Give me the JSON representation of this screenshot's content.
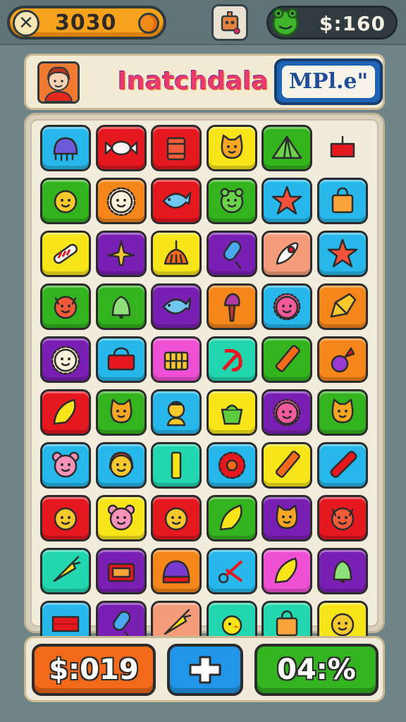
{
  "topbar": {
    "score": "3030",
    "money": "$:160"
  },
  "header": {
    "title": "Inatchdala",
    "mode_label": "MPl.e\""
  },
  "bottom": {
    "left_label": "$:019",
    "mid_label": "",
    "right_label": "04:%"
  },
  "colors": {
    "blue": "#27b7ea",
    "red": "#e5171f",
    "yellow": "#f7e51a",
    "green": "#33b41f",
    "orange": "#f4861a",
    "purple": "#7a1fb3",
    "teal": "#22d6b0",
    "pink": "#ef4fd2",
    "salmon": "#f59d7a"
  },
  "board": {
    "rows": [
      [
        {
          "c": "blue",
          "i": "octopus-icon"
        },
        {
          "c": "red",
          "i": "candy-icon"
        },
        {
          "c": "red",
          "i": "drum-icon"
        },
        {
          "c": "yellow",
          "i": "cat-face-icon"
        },
        {
          "c": "green",
          "i": "tent-icon"
        },
        {
          "c": "none",
          "i": "box-icon"
        }
      ],
      [
        {
          "c": "green",
          "i": "face-icon"
        },
        {
          "c": "orange",
          "i": "lion-icon"
        },
        {
          "c": "red",
          "i": "fish-icon"
        },
        {
          "c": "green",
          "i": "frog-icon"
        },
        {
          "c": "blue",
          "i": "star-icon"
        },
        {
          "c": "blue",
          "i": "bag-icon"
        }
      ],
      [
        {
          "c": "yellow",
          "i": "candy-cane-icon"
        },
        {
          "c": "purple",
          "i": "plane-icon"
        },
        {
          "c": "yellow",
          "i": "broom-icon"
        },
        {
          "c": "purple",
          "i": "popsicle-icon"
        },
        {
          "c": "salmon",
          "i": "rocket-icon"
        },
        {
          "c": "blue",
          "i": "star-icon"
        }
      ],
      [
        {
          "c": "green",
          "i": "devil-face-icon"
        },
        {
          "c": "green",
          "i": "bell-icon"
        },
        {
          "c": "purple",
          "i": "fish-icon"
        },
        {
          "c": "orange",
          "i": "torch-icon"
        },
        {
          "c": "blue",
          "i": "sun-face-icon"
        },
        {
          "c": "orange",
          "i": "crayon-icon"
        }
      ],
      [
        {
          "c": "purple",
          "i": "lion-icon"
        },
        {
          "c": "blue",
          "i": "basket-icon"
        },
        {
          "c": "pink",
          "i": "cart-icon"
        },
        {
          "c": "teal",
          "i": "hammer-sickle-icon"
        },
        {
          "c": "green",
          "i": "pencil-icon"
        },
        {
          "c": "orange",
          "i": "radish-icon"
        }
      ],
      [
        {
          "c": "red",
          "i": "shell-icon"
        },
        {
          "c": "green",
          "i": "cat-face-icon"
        },
        {
          "c": "blue",
          "i": "person-icon"
        },
        {
          "c": "yellow",
          "i": "pot-icon"
        },
        {
          "c": "purple",
          "i": "sun-face-icon"
        },
        {
          "c": "green",
          "i": "cat-face-icon"
        }
      ],
      [
        {
          "c": "blue",
          "i": "bear-icon"
        },
        {
          "c": "blue",
          "i": "girl-icon"
        },
        {
          "c": "teal",
          "i": "bar-icon"
        },
        {
          "c": "blue",
          "i": "flower-icon"
        },
        {
          "c": "yellow",
          "i": "pencil-icon"
        },
        {
          "c": "blue",
          "i": "marker-icon"
        }
      ],
      [
        {
          "c": "red",
          "i": "face-icon"
        },
        {
          "c": "yellow",
          "i": "bear-icon"
        },
        {
          "c": "red",
          "i": "face-icon"
        },
        {
          "c": "green",
          "i": "shell-icon"
        },
        {
          "c": "purple",
          "i": "cat-face-icon"
        },
        {
          "c": "red",
          "i": "devil-face-icon"
        }
      ],
      [
        {
          "c": "teal",
          "i": "carrot-icon"
        },
        {
          "c": "purple",
          "i": "radio-icon"
        },
        {
          "c": "orange",
          "i": "cake-icon"
        },
        {
          "c": "blue",
          "i": "scissors-icon"
        },
        {
          "c": "pink",
          "i": "shell-icon"
        },
        {
          "c": "purple",
          "i": "bell-icon"
        }
      ],
      [
        {
          "c": "blue",
          "i": "brick-icon"
        },
        {
          "c": "purple",
          "i": "popsicle-icon"
        },
        {
          "c": "salmon",
          "i": "carrot-icon"
        },
        {
          "c": "teal",
          "i": "chick-icon"
        },
        {
          "c": "teal",
          "i": "bag-icon"
        },
        {
          "c": "yellow",
          "i": "face-icon"
        }
      ]
    ]
  }
}
